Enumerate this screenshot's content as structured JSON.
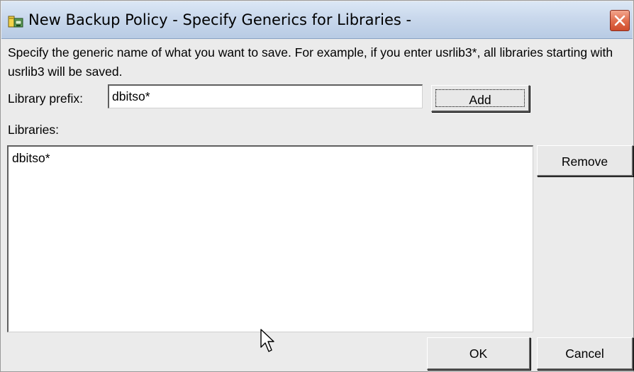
{
  "window": {
    "title": "New Backup Policy - Specify Generics for Libraries -",
    "icon": "backup-policy-icon",
    "close_icon": "close-icon"
  },
  "instructions": "Specify the generic name of what you want to save.  For example, if you enter usrlib3*, all libraries starting with usrlib3 will be saved.",
  "prefix": {
    "label": "Library prefix:",
    "value": "dbitso*"
  },
  "buttons": {
    "add": "Add",
    "remove": "Remove",
    "ok": "OK",
    "cancel": "Cancel"
  },
  "libraries": {
    "label": "Libraries:",
    "items": [
      "dbitso*"
    ]
  },
  "colors": {
    "titlebar": "#c9d8ec",
    "close_button": "#e06b4a",
    "dialog_background": "#ebebeb"
  }
}
